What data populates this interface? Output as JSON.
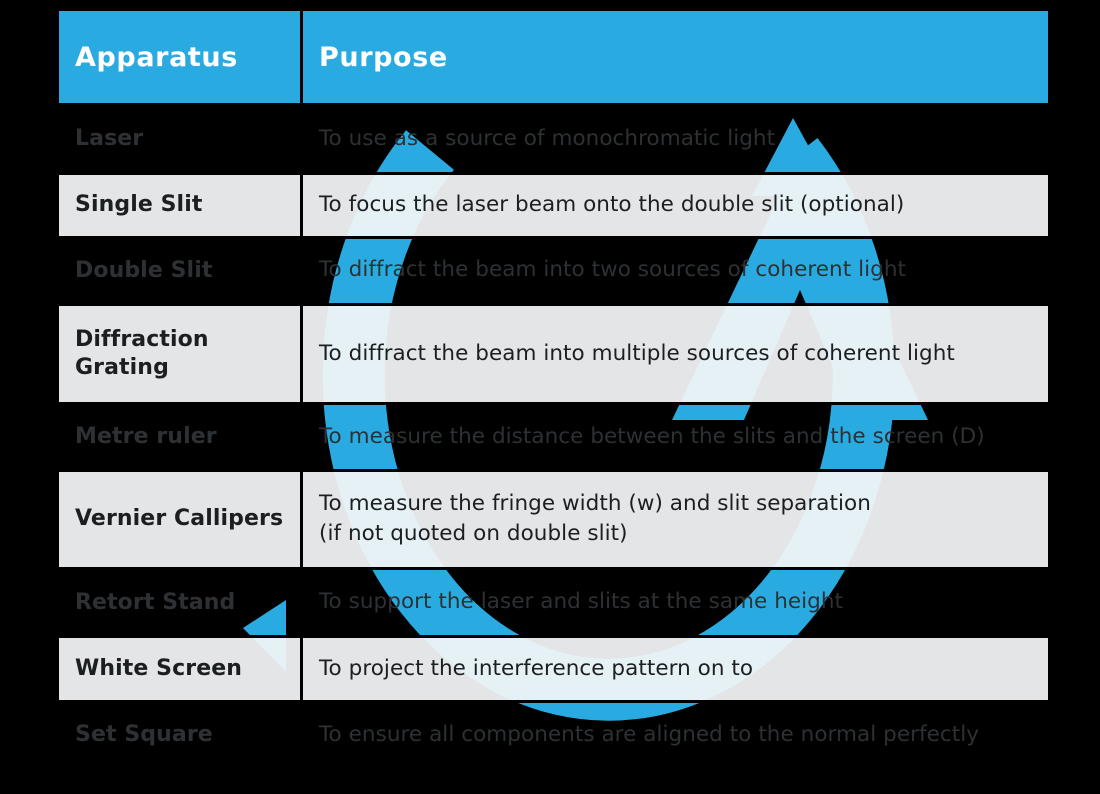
{
  "page": {
    "background_color": "#000000",
    "accent_color": "#29abe2",
    "light_row_color": "#f4f6f7",
    "dark_row_text_color": "#2e3133",
    "light_row_text_color": "#1c1f21",
    "watermark_name": "circular-arrow-a-logo"
  },
  "table": {
    "headers": {
      "apparatus": "Apparatus",
      "purpose": "Purpose"
    },
    "rows": [
      {
        "apparatus": "Laser",
        "purpose_lines": [
          "To use as a source of monochromatic light"
        ]
      },
      {
        "apparatus": "Single Slit",
        "purpose_lines": [
          "To focus the laser beam onto the double slit (optional)"
        ]
      },
      {
        "apparatus": "Double Slit",
        "purpose_lines": [
          "To diffract the beam into two sources of coherent light"
        ]
      },
      {
        "apparatus_lines": [
          "Diffraction",
          "Grating"
        ],
        "apparatus": "Diffraction Grating",
        "purpose_lines": [
          "To diffract the beam into multiple sources of coherent light"
        ]
      },
      {
        "apparatus": "Metre ruler",
        "purpose_lines": [
          "To measure the distance between the slits and the screen (D)"
        ]
      },
      {
        "apparatus": "Vernier Callipers",
        "purpose_lines": [
          "To measure the fringe width (w) and slit separation",
          "(if not quoted on double slit)"
        ]
      },
      {
        "apparatus": "Retort Stand",
        "purpose_lines": [
          "To support the laser and slits at the same height"
        ]
      },
      {
        "apparatus": "White Screen",
        "purpose_lines": [
          "To project the interference pattern on to"
        ]
      },
      {
        "apparatus": "Set Square",
        "purpose_lines": [
          "To ensure all components are aligned to the normal perfectly"
        ]
      }
    ]
  }
}
